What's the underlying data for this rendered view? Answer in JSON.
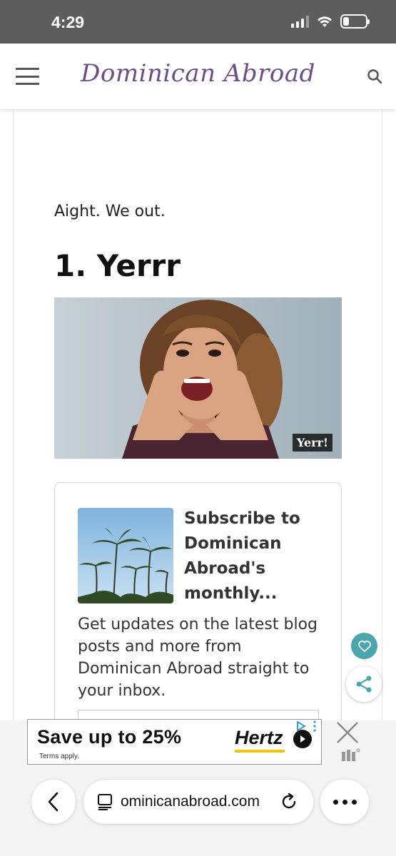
{
  "status_bar": {
    "time": "4:29",
    "battery_level": 0.25
  },
  "header": {
    "site_title": "Dominican Abroad",
    "brand_color": "#6b4e8a"
  },
  "article": {
    "intro": "Aight. We out.",
    "section_heading": "1. Yerrr",
    "image_caption": "Yerr!"
  },
  "subscribe_card": {
    "title": "Subscribe to Dominican Abroad's monthly...",
    "description": "Get updates on the latest blog posts and more from Dominican Abroad straight to your inbox."
  },
  "floating_actions": {
    "heart_color": "#4aa6ad"
  },
  "ad": {
    "headline": "Save up to 25%",
    "terms": "Terms apply.",
    "brand": "Hertz",
    "brand_accent": "#f5c400"
  },
  "browser": {
    "url": "dominicanabroad.com",
    "url_display": "ominicanabroad.com"
  }
}
